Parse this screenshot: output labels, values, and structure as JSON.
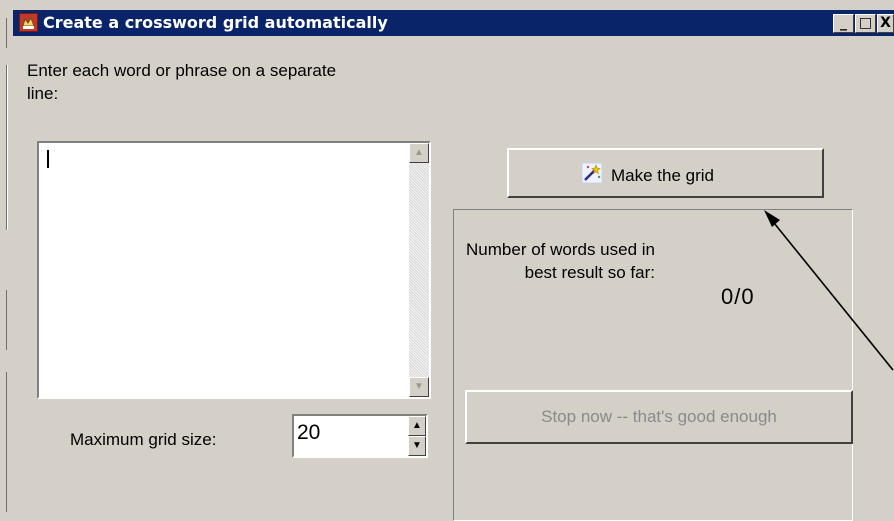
{
  "window": {
    "title": "Create a crossword grid automatically",
    "controls": {
      "minimize": "_",
      "maximize": "□",
      "close": "X"
    }
  },
  "input_panel": {
    "prompt": "Enter each word or phrase on a separate line:",
    "words_text": "",
    "max_grid_label": "Maximum grid size:",
    "max_grid_value": "20"
  },
  "actions": {
    "make_grid_label": "Make the grid",
    "stop_label": "Stop now -- that's good enough"
  },
  "status": {
    "words_used_label": "Number of words used in best result so far:",
    "words_used_value": "0/0"
  },
  "icons": [
    "app-icon",
    "magic-wand-icon",
    "scroll-up-icon",
    "scroll-down-icon",
    "spin-up-icon",
    "spin-down-icon"
  ]
}
